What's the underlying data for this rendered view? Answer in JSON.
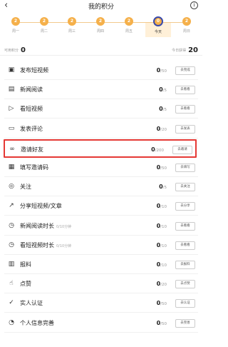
{
  "header": {
    "title": "我的积分",
    "back_icon": "chevron-left-icon",
    "info_icon": "info-icon"
  },
  "days": [
    {
      "label": "周一",
      "points": "2"
    },
    {
      "label": "周二",
      "points": "2"
    },
    {
      "label": "周三",
      "points": "2"
    },
    {
      "label": "周四",
      "points": "2"
    },
    {
      "label": "周五",
      "points": "2"
    },
    {
      "label": "今天",
      "points": "0",
      "today": true
    },
    {
      "label": "周日",
      "points": "2"
    }
  ],
  "summary": {
    "left_label": "可用积分",
    "left_value": "0",
    "right_label": "今日获得",
    "right_value": "20"
  },
  "tasks": [
    {
      "label": "发布短视频",
      "sub": "",
      "score": "0",
      "max": "/50",
      "button": "去完成",
      "icon": "video-post-icon"
    },
    {
      "label": "新闻阅读",
      "sub": "",
      "score": "0",
      "max": "/5",
      "button": "去看看",
      "icon": "news-icon"
    },
    {
      "label": "看短视频",
      "sub": "",
      "score": "0",
      "max": "/5",
      "button": "去看看",
      "icon": "play-icon"
    },
    {
      "label": "发表评论",
      "sub": "",
      "score": "0",
      "max": "/20",
      "button": "去发表",
      "icon": "comment-icon"
    },
    {
      "label": "邀请好友",
      "sub": "",
      "score": "0",
      "max": "/200",
      "button": "去邀请",
      "icon": "invite-icon",
      "highlight": true
    },
    {
      "label": "填写邀请码",
      "sub": "",
      "score": "0",
      "max": "/50",
      "button": "去填写",
      "icon": "keyboard-icon"
    },
    {
      "label": "关注",
      "sub": "",
      "score": "0",
      "max": "/5",
      "button": "去关注",
      "icon": "follow-icon"
    },
    {
      "label": "分享短视频/文章",
      "sub": "",
      "score": "0",
      "max": "/10",
      "button": "去分享",
      "icon": "share-icon"
    },
    {
      "label": "新闻阅读时长",
      "sub": "0/10分钟",
      "score": "0",
      "max": "/10",
      "button": "去看看",
      "icon": "read-timer-icon"
    },
    {
      "label": "看短视频时长",
      "sub": "0/10分钟",
      "score": "0",
      "max": "/10",
      "button": "去看看",
      "icon": "video-timer-icon"
    },
    {
      "label": "报料",
      "sub": "",
      "score": "0",
      "max": "/10",
      "button": "去报料",
      "icon": "report-icon"
    },
    {
      "label": "点赞",
      "sub": "",
      "score": "0",
      "max": "/20",
      "button": "去点赞",
      "icon": "thumbs-up-icon"
    },
    {
      "label": "实人认证",
      "sub": "",
      "score": "0",
      "max": "/50",
      "button": "去认证",
      "icon": "verify-icon"
    },
    {
      "label": "个人信息完善",
      "sub": "",
      "score": "0",
      "max": "/50",
      "button": "去完善",
      "icon": "profile-icon"
    }
  ]
}
